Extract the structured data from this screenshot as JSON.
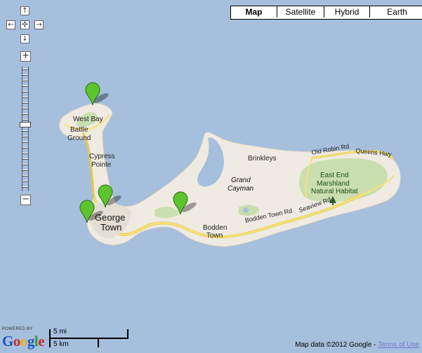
{
  "controls": {
    "pan": {
      "up": "↑",
      "left": "←",
      "center": "✣",
      "right": "→",
      "down": "↓"
    },
    "zoom": {
      "plus": "+",
      "minus": "−"
    }
  },
  "map_types": [
    {
      "label": "Map",
      "active": true
    },
    {
      "label": "Satellite",
      "active": false
    },
    {
      "label": "Hybrid",
      "active": false
    },
    {
      "label": "Earth",
      "active": false
    }
  ],
  "places": {
    "west_bay": "West Bay",
    "battle_ground_1": "Battle",
    "battle_ground_2": "Ground",
    "cypress_1": "Cypress",
    "cypress_2": "Pointe",
    "george_1": "George",
    "george_2": "Town",
    "grand_1": "Grand",
    "grand_2": "Cayman",
    "brinkleys": "Brinkleys",
    "bodden_1": "Bodden",
    "bodden_2": "Town",
    "east_end_1": "East End",
    "east_end_2": "Marshland",
    "east_end_3": "Natural Habitat"
  },
  "roads": {
    "old_robin": "Old Robin Rd",
    "queens": "Queens Hwy",
    "bodden_town_rd": "Bodden Town Rd",
    "seaview": "Seaview Rd"
  },
  "markers_count": 4,
  "scale": {
    "mi": "5 mi",
    "km": "5 km"
  },
  "branding": {
    "powered": "POWERED BY",
    "g1": "G",
    "o1": "o",
    "o2": "o",
    "g2": "g",
    "l": "l",
    "e": "e"
  },
  "attribution": {
    "text": "Map data ©2012 Google - ",
    "terms": "Terms of Use"
  },
  "colors": {
    "water": "#a5bfdd",
    "land": "#efebe2",
    "road": "#f6e27a",
    "park": "#c9dfaf",
    "marker": "#5dc42d"
  }
}
